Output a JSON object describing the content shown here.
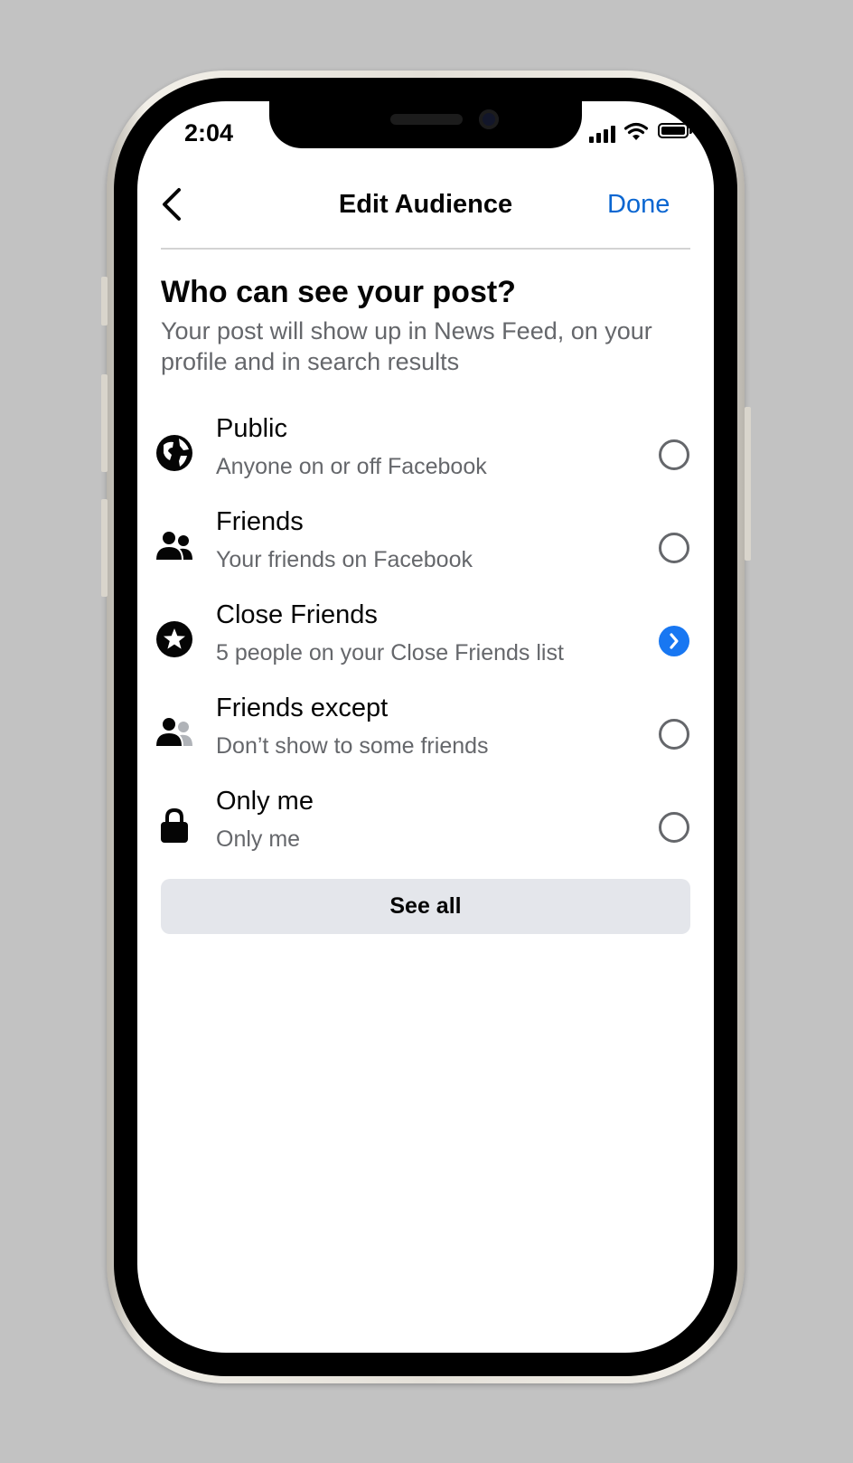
{
  "status_bar": {
    "time": "2:04"
  },
  "nav": {
    "title": "Edit Audience",
    "done_label": "Done"
  },
  "heading": "Who can see your post?",
  "subheading": "Your post will show up in News Feed, on your profile and in search results",
  "options": [
    {
      "icon": "globe-icon",
      "title": "Public",
      "description": "Anyone on or off Facebook",
      "selected": false
    },
    {
      "icon": "friends-icon",
      "title": "Friends",
      "description": "Your friends on Facebook",
      "selected": false
    },
    {
      "icon": "star-icon",
      "title": "Close Friends",
      "description": "5 people on your Close Friends list",
      "selected": true
    },
    {
      "icon": "friends-except-icon",
      "title": "Friends except",
      "description": "Don’t show to some friends",
      "selected": false
    },
    {
      "icon": "lock-icon",
      "title": "Only me",
      "description": "Only me",
      "selected": false
    }
  ],
  "see_all_label": "See all",
  "colors": {
    "accent": "#1877f2",
    "link": "#0a66d1",
    "secondary_text": "#65676b",
    "button_bg": "#e4e6eb"
  }
}
